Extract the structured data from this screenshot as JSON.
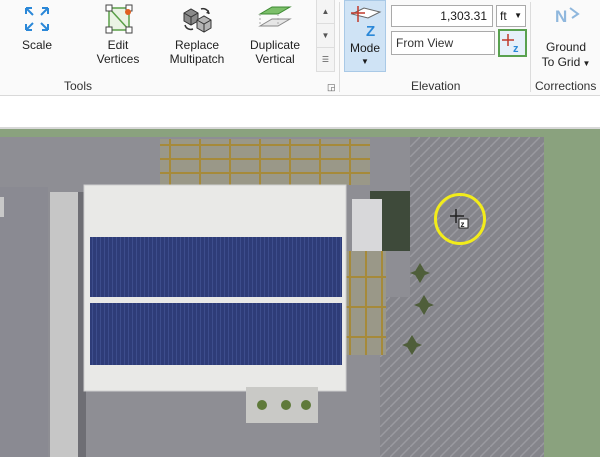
{
  "tools": {
    "group_label": "Tools",
    "scale": {
      "label": "Scale",
      "icon": "scale-arrows-icon"
    },
    "edit_vertices": {
      "label_line1": "Edit",
      "label_line2": "Vertices",
      "icon": "edit-vertices-icon"
    },
    "replace_multipatch": {
      "label_line1": "Replace",
      "label_line2": "Multipatch",
      "icon": "replace-multipatch-icon"
    },
    "duplicate_vertical": {
      "label_line1": "Duplicate",
      "label_line2": "Vertical",
      "icon": "duplicate-vertical-icon"
    }
  },
  "elevation": {
    "group_label": "Elevation",
    "mode_label": "Mode",
    "value": "1,303.31",
    "unit": "ft",
    "source": "From View",
    "pick_icon": "pick-elevation-icon"
  },
  "corrections": {
    "group_label": "Corrections",
    "ground_line1": "Ground",
    "ground_line2": "To Grid",
    "icon": "ground-to-grid-icon"
  },
  "colors": {
    "accent": "#2b88d8",
    "mode_active": "#cfe3f5",
    "pick_border": "#59a14f",
    "cursor_ring": "#f2ec1a"
  }
}
